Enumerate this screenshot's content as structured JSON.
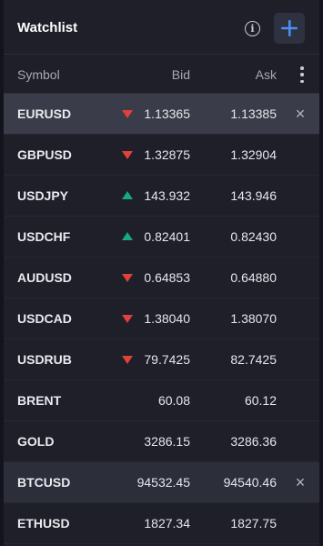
{
  "header": {
    "title": "Watchlist",
    "info_icon": "info-icon",
    "add_icon": "plus-icon"
  },
  "columns": {
    "symbol": "Symbol",
    "bid": "Bid",
    "ask": "Ask"
  },
  "colors": {
    "panel_bg": "#1e1f29",
    "selected_row": "#3a3c49",
    "accent_plus": "#4a8ff0",
    "down": "#e0413c",
    "up": "#17a88a"
  },
  "rows": [
    {
      "symbol": "EURUSD",
      "bid": "1.13365",
      "ask": "1.13385",
      "trend": "down",
      "selected": true,
      "closable": true
    },
    {
      "symbol": "GBPUSD",
      "bid": "1.32875",
      "ask": "1.32904",
      "trend": "down"
    },
    {
      "symbol": "USDJPY",
      "bid": "143.932",
      "ask": "143.946",
      "trend": "up"
    },
    {
      "symbol": "USDCHF",
      "bid": "0.82401",
      "ask": "0.82430",
      "trend": "up"
    },
    {
      "symbol": "AUDUSD",
      "bid": "0.64853",
      "ask": "0.64880",
      "trend": "down"
    },
    {
      "symbol": "USDCAD",
      "bid": "1.38040",
      "ask": "1.38070",
      "trend": "down"
    },
    {
      "symbol": "USDRUB",
      "bid": "79.7425",
      "ask": "82.7425",
      "trend": "down"
    },
    {
      "symbol": "BRENT",
      "bid": "60.08",
      "ask": "60.12",
      "trend": "none"
    },
    {
      "symbol": "GOLD",
      "bid": "3286.15",
      "ask": "3286.36",
      "trend": "none"
    },
    {
      "symbol": "BTCUSD",
      "bid": "94532.45",
      "ask": "94540.46",
      "trend": "none",
      "hovered": true,
      "closable": true
    },
    {
      "symbol": "ETHUSD",
      "bid": "1827.34",
      "ask": "1827.75",
      "trend": "none"
    }
  ]
}
